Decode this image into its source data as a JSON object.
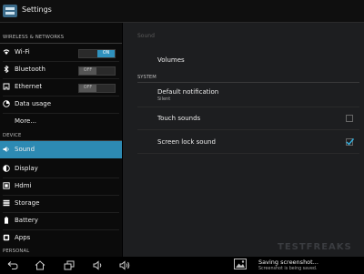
{
  "app": {
    "title": "Settings",
    "icon": "settings-app-icon"
  },
  "sidebar": {
    "headers": {
      "wireless": "WIRELESS & NETWORKS",
      "device": "DEVICE",
      "personal": "PERSONAL"
    },
    "items": [
      {
        "label": "Wi-Fi",
        "icon": "wifi-icon",
        "toggle": "ON"
      },
      {
        "label": "Bluetooth",
        "icon": "bluetooth-icon",
        "toggle": "OFF"
      },
      {
        "label": "Ethernet",
        "icon": "ethernet-icon",
        "toggle": "OFF"
      },
      {
        "label": "Data usage",
        "icon": "data-usage-icon"
      },
      {
        "label": "More...",
        "icon": ""
      },
      {
        "label": "Sound",
        "icon": "volume-icon",
        "selected": true
      },
      {
        "label": "Display",
        "icon": "brightness-icon"
      },
      {
        "label": "Hdmi",
        "icon": "hdmi-icon"
      },
      {
        "label": "Storage",
        "icon": "storage-icon"
      },
      {
        "label": "Battery",
        "icon": "battery-icon"
      },
      {
        "label": "Apps",
        "icon": "apps-icon"
      }
    ]
  },
  "detail": {
    "title": "Sound",
    "volumes": "Volumes",
    "system_header": "SYSTEM",
    "default_notification": {
      "label": "Default notification",
      "value": "Silent"
    },
    "touch_sounds": {
      "label": "Touch sounds",
      "checked": false
    },
    "screen_lock_sound": {
      "label": "Screen lock sound",
      "checked": true
    }
  },
  "watermark": "TESTFREAKS",
  "notification": {
    "title": "Saving screenshot...",
    "subtitle": "Screenshot is being saved."
  },
  "navbar": {
    "icons": [
      "back-icon",
      "home-icon",
      "recent-apps-icon",
      "volume-down-icon",
      "volume-up-icon"
    ]
  },
  "colors": {
    "accent": "#2d8ab3",
    "panel": "#1d1e20"
  }
}
